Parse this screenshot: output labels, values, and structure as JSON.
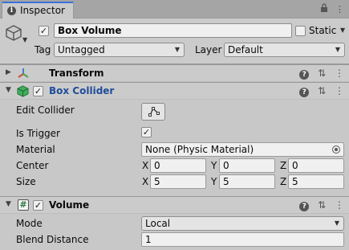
{
  "tab": {
    "label": "Inspector"
  },
  "header": {
    "name": "Box Volume",
    "static_label": "Static",
    "tag_label": "Tag",
    "tag_value": "Untagged",
    "layer_label": "Layer",
    "layer_value": "Default"
  },
  "transform": {
    "title": "Transform"
  },
  "box_collider": {
    "title": "Box Collider",
    "edit_collider_label": "Edit Collider",
    "is_trigger_label": "Is Trigger",
    "material_label": "Material",
    "material_value": "None (Physic Material)",
    "center_label": "Center",
    "size_label": "Size",
    "center": {
      "x": "0",
      "y": "0",
      "z": "0"
    },
    "size": {
      "x": "5",
      "y": "5",
      "z": "5"
    },
    "axis_x": "X",
    "axis_y": "Y",
    "axis_z": "Z"
  },
  "volume": {
    "title": "Volume",
    "mode_label": "Mode",
    "mode_value": "Local",
    "blend_label": "Blend Distance",
    "blend_value": "1"
  }
}
